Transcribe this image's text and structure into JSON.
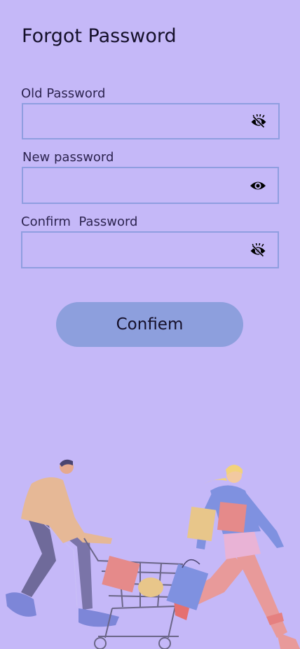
{
  "page": {
    "title": "Forgot Password"
  },
  "fields": {
    "old_password": {
      "label": "Old Password",
      "value": "",
      "visibility": "hidden",
      "toggle_icon": "eye-slash-icon"
    },
    "new_password": {
      "label": "New password",
      "value": "",
      "visibility": "shown",
      "toggle_icon": "eye-icon"
    },
    "confirm_password": {
      "label": "Confirm  Password",
      "value": "",
      "visibility": "hidden",
      "toggle_icon": "eye-slash-icon"
    }
  },
  "actions": {
    "confirm_label": "Confiem"
  },
  "theme": {
    "background": "#c5b8f8",
    "field_border": "#8f9ee0",
    "button": "#8d9fdd"
  }
}
